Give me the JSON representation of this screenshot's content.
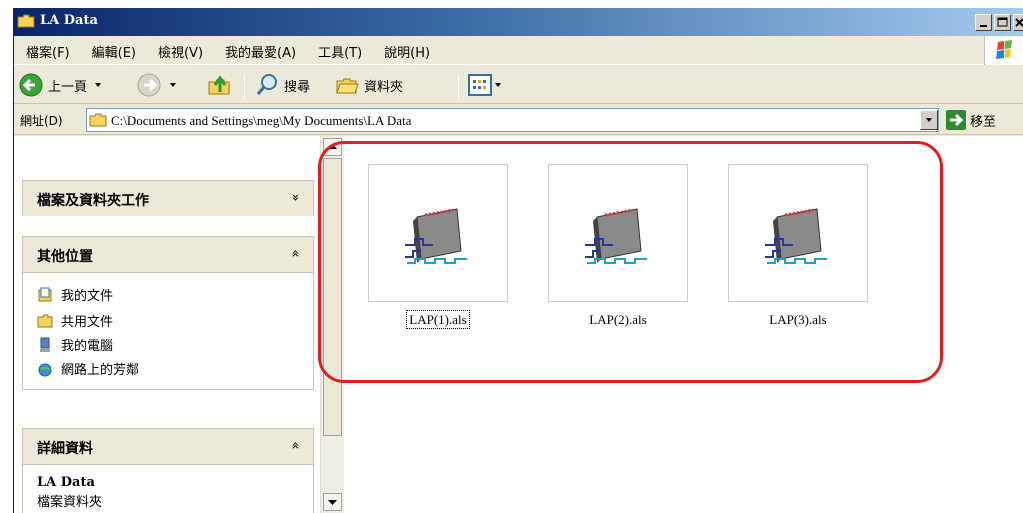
{
  "window": {
    "title": "LA Data"
  },
  "menu": {
    "items": [
      "檔案(F)",
      "編輯(E)",
      "檢視(V)",
      "我的最愛(A)",
      "工具(T)",
      "說明(H)"
    ]
  },
  "toolbar": {
    "back_label": "上一頁",
    "search_label": "搜尋",
    "folders_label": "資料夾"
  },
  "address": {
    "label": "網址(D)",
    "value": "C:\\Documents and Settings\\meg\\My Documents\\LA Data",
    "go_label": "移至"
  },
  "taskpane": {
    "file_tasks": {
      "title": "檔案及資料夾工作",
      "chevron": "»"
    },
    "other_places": {
      "title": "其他位置",
      "chevron": "«",
      "items": [
        "我的文件",
        "共用文件",
        "我的電腦",
        "網路上的芳鄰"
      ]
    },
    "details": {
      "title": "詳細資料",
      "chevron": "«",
      "name": "LA Data",
      "type": "檔案資料夾"
    }
  },
  "files": [
    {
      "name": "LAP(1).als",
      "selected": true
    },
    {
      "name": "LAP(2).als",
      "selected": false
    },
    {
      "name": "LAP(3).als",
      "selected": false
    }
  ],
  "colors": {
    "highlight": "#e02020",
    "titlebar": "#0a246a",
    "chrome": "#ece9d8"
  }
}
